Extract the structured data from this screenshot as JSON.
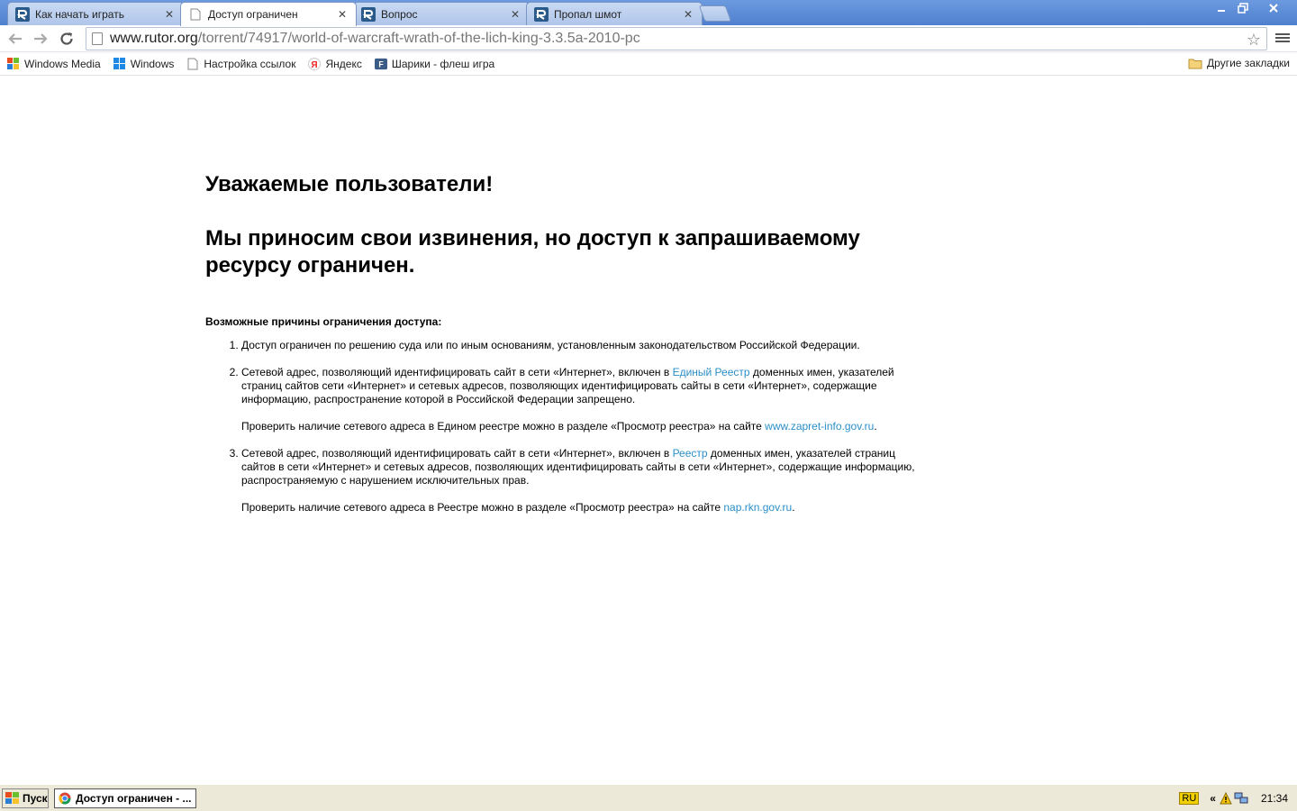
{
  "tabs": [
    {
      "label": "Как начать играть",
      "active": false
    },
    {
      "label": "Доступ ограничен",
      "active": true
    },
    {
      "label": "Вопрос",
      "active": false
    },
    {
      "label": "Пропал шмот",
      "active": false
    }
  ],
  "toolbar": {
    "url_host": "www.rutor.org",
    "url_path": "/torrent/74917/world-of-warcraft-wrath-of-the-lich-king-3.3.5a-2010-pc"
  },
  "bookmarks": [
    {
      "label": "Windows Media",
      "icon": "windows-media-icon"
    },
    {
      "label": "Windows",
      "icon": "windows-logo-icon"
    },
    {
      "label": "Настройка ссылок",
      "icon": "page-icon"
    },
    {
      "label": "Яндекс",
      "icon": "yandex-icon"
    },
    {
      "label": "Шарики - флеш игра",
      "icon": "game-icon"
    }
  ],
  "other_bookmarks": "Другие закладки",
  "page": {
    "heading": "Уважаемые пользователи!",
    "subheading": "Мы приносим свои извинения, но доступ к запрашиваемому ресурсу ограничен.",
    "reasons_title": "Возможные причины ограничения доступа:",
    "reason1": "Доступ ограничен  по решению суда или по иным основаниям, установленным законодательством Российской Федерации.",
    "reason2_a": "Сетевой адрес, позволяющий идентифицировать сайт в сети «Интернет», включен в ",
    "reason2_link": "Единый Реестр",
    "reason2_b": " доменных имен, указателей страниц сайтов сети «Интернет» и сетевых адресов, позволяющих идентифицировать сайты в сети «Интернет», содержащие информацию, распространение которой в Российской Федерации запрещено.",
    "reason2_check_a": "Проверить наличие сетевого адреса в Едином реестре можно в разделе «Просмотр реестра» на сайте ",
    "reason2_check_link": "www.zapret-info.gov.ru",
    "reason2_check_b": ".",
    "reason3_a": "Сетевой адрес, позволяющий идентифицировать сайт в сети «Интернет», включен в ",
    "reason3_link": "Реестр",
    "reason3_b": " доменных имен, указателей страниц сайтов в сети «Интернет» и сетевых адресов, позволяющих идентифицировать сайты в сети «Интернет», содержащие информацию, распространяемую с нарушением исключительных прав.",
    "reason3_check_a": "Проверить наличие сетевого адреса в Реестре можно в разделе «Просмотр реестра» на сайте ",
    "reason3_check_link": "nap.rkn.gov.ru",
    "reason3_check_b": "."
  },
  "taskbar": {
    "start_label": "Пуск",
    "task_label": "Доступ ограничен - ...",
    "lang": "RU",
    "chevron": "«",
    "time": "21:34"
  },
  "colors": {
    "link": "#2b8fc7",
    "tabstrip": "#5b8bd6"
  }
}
